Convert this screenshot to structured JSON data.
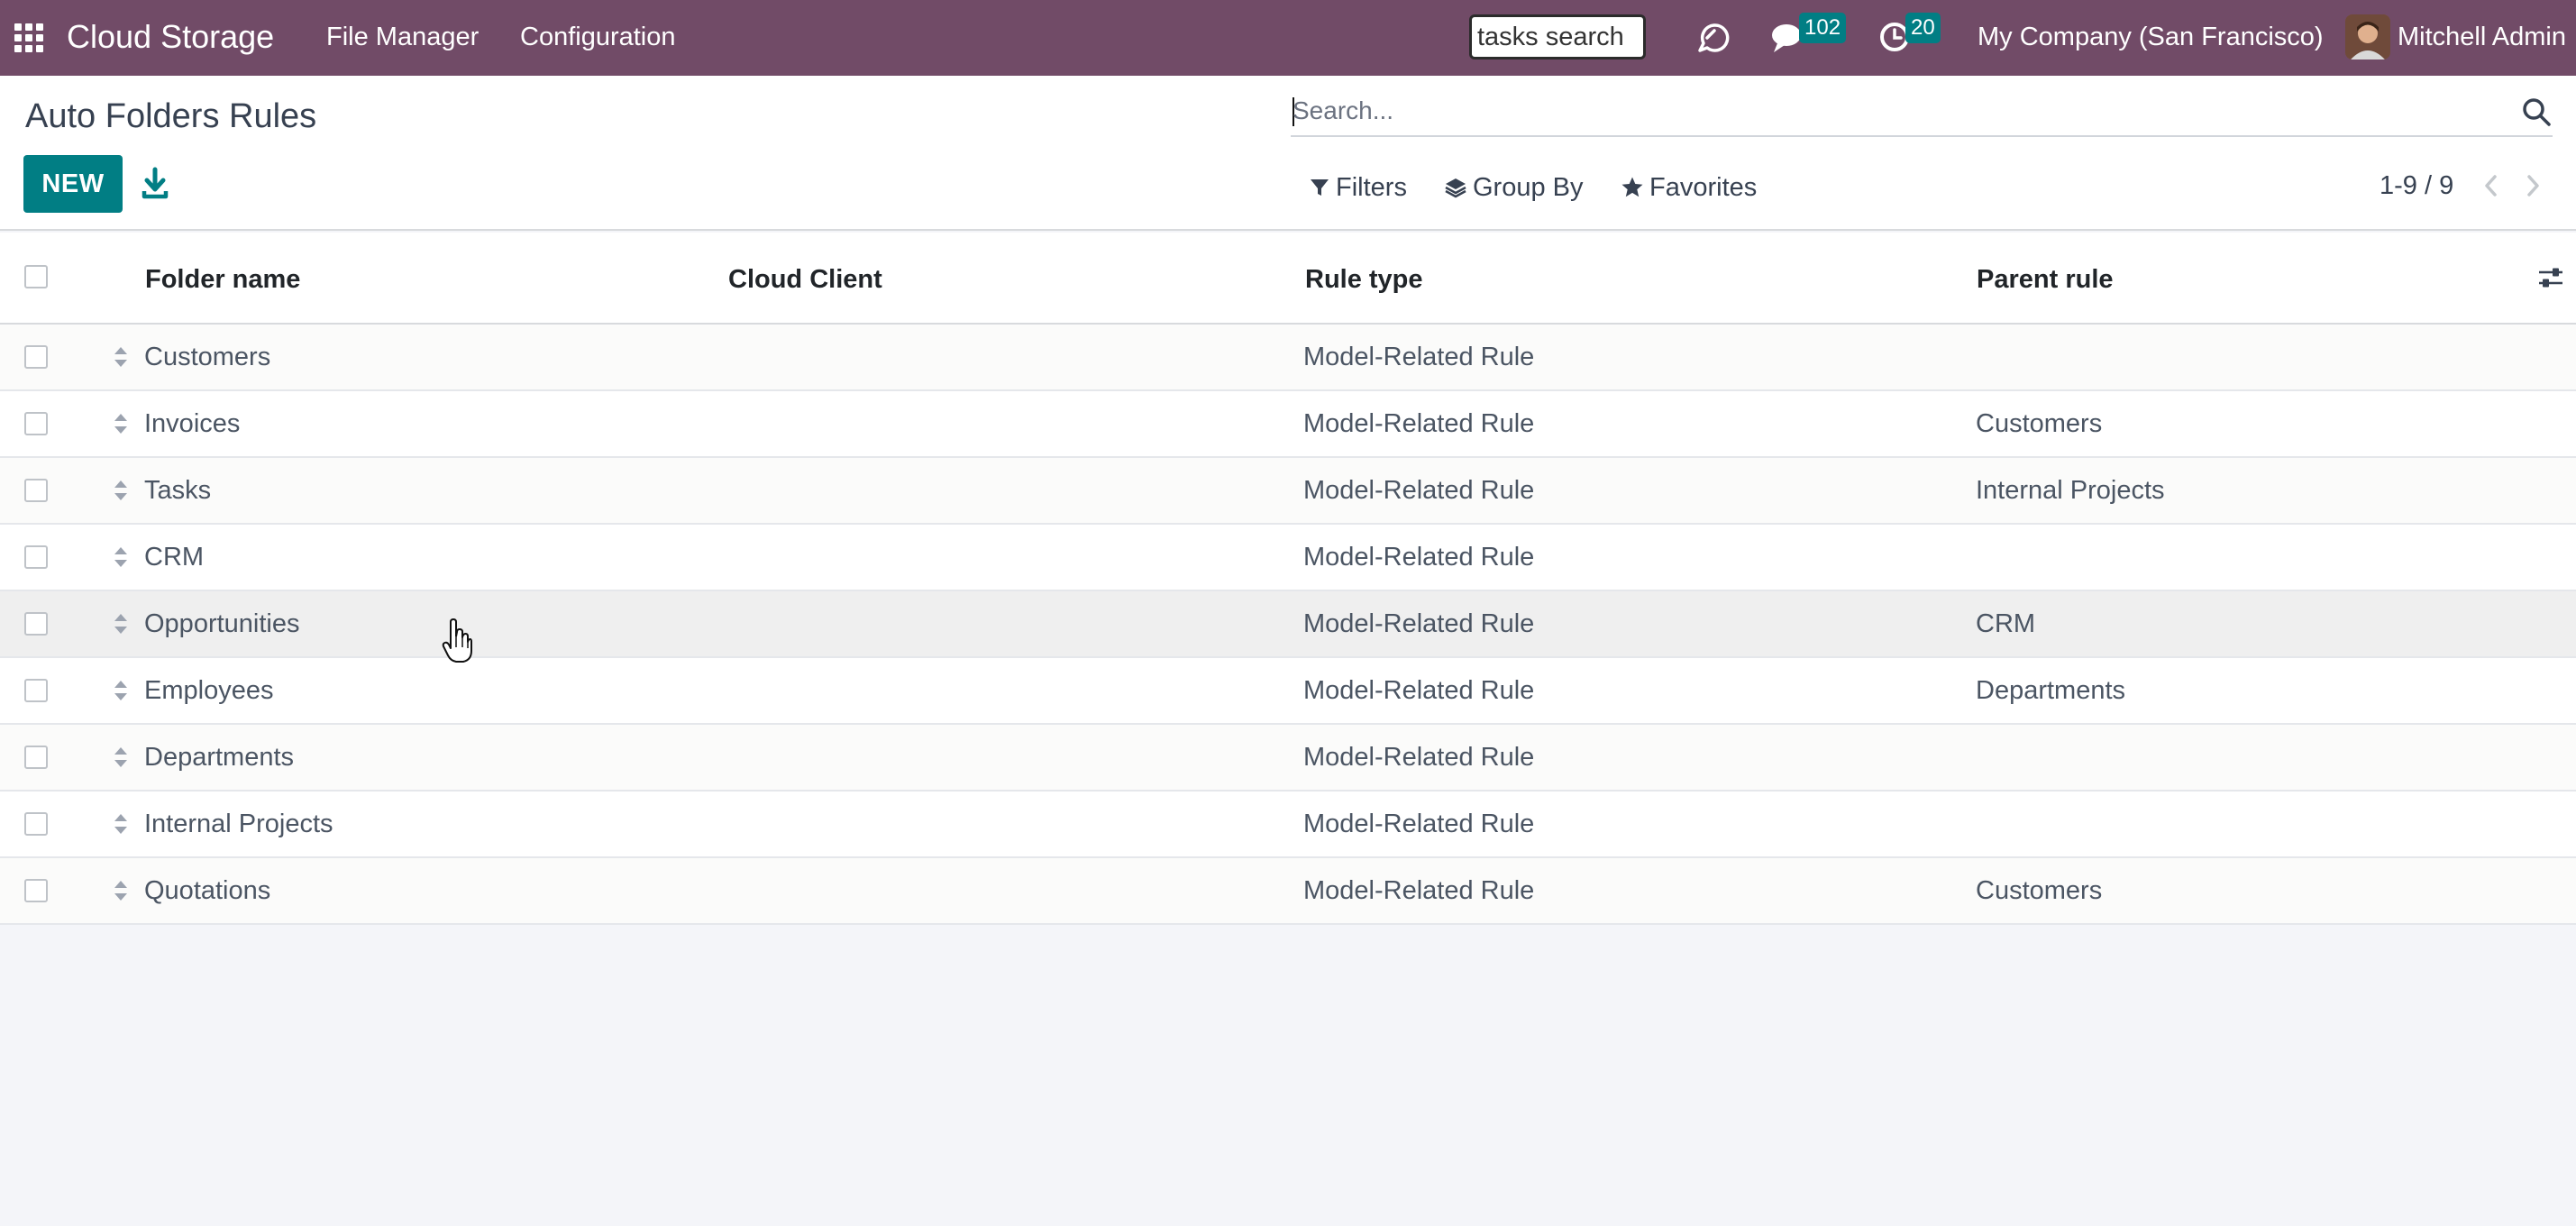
{
  "navbar": {
    "app_name": "Cloud Storage",
    "menu": [
      "File Manager",
      "Configuration"
    ],
    "quick_search_value": "tasks search",
    "messages_count": "102",
    "activities_count": "20",
    "company": "My Company (San Francisco)",
    "user": "Mitchell Admin"
  },
  "control_panel": {
    "title": "Auto Folders Rules",
    "new_label": "NEW",
    "search_placeholder": "Search...",
    "filters_label": "Filters",
    "group_by_label": "Group By",
    "favorites_label": "Favorites",
    "pager_value": "1-9 / 9"
  },
  "table": {
    "columns": [
      "Folder name",
      "Cloud Client",
      "Rule type",
      "Parent rule"
    ],
    "rows": [
      {
        "name": "Customers",
        "client": "",
        "type": "Model-Related Rule",
        "parent": ""
      },
      {
        "name": "Invoices",
        "client": "",
        "type": "Model-Related Rule",
        "parent": "Customers"
      },
      {
        "name": "Tasks",
        "client": "",
        "type": "Model-Related Rule",
        "parent": "Internal Projects"
      },
      {
        "name": "CRM",
        "client": "",
        "type": "Model-Related Rule",
        "parent": ""
      },
      {
        "name": "Opportunities",
        "client": "",
        "type": "Model-Related Rule",
        "parent": "CRM"
      },
      {
        "name": "Employees",
        "client": "",
        "type": "Model-Related Rule",
        "parent": "Departments"
      },
      {
        "name": "Departments",
        "client": "",
        "type": "Model-Related Rule",
        "parent": ""
      },
      {
        "name": "Internal Projects",
        "client": "",
        "type": "Model-Related Rule",
        "parent": ""
      },
      {
        "name": "Quotations",
        "client": "",
        "type": "Model-Related Rule",
        "parent": "Customers"
      }
    ]
  },
  "colors": {
    "navbar_bg": "#714b67",
    "primary_button": "#017e84",
    "badge_bg": "#017e84"
  }
}
